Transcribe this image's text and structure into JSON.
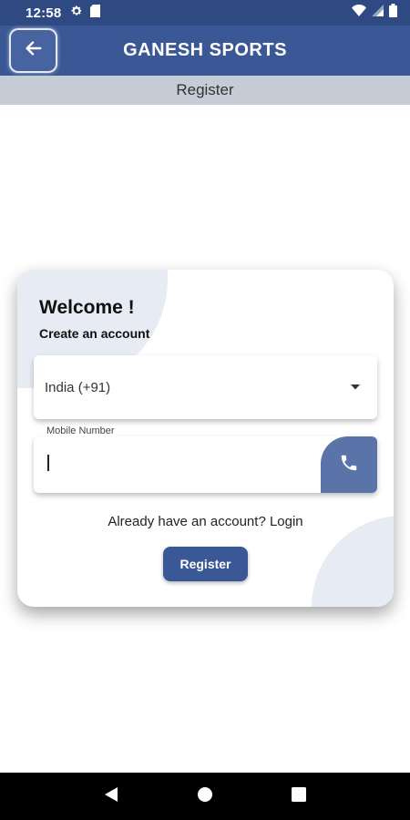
{
  "status_bar": {
    "time": "12:58"
  },
  "app_bar": {
    "title": "GANESH SPORTS"
  },
  "sub_header": {
    "title": "Register"
  },
  "card": {
    "welcome": "Welcome !",
    "subtitle": "Create an account",
    "country_select": {
      "selected": "India (+91)"
    },
    "mobile_field": {
      "label": "Mobile Number",
      "value": ""
    },
    "login_link": "Already have an account? Login",
    "register_button": "Register"
  },
  "icons": {
    "back": "arrow-left-icon",
    "settings": "gear-icon",
    "sim": "sim-card-icon",
    "wifi": "wifi-icon",
    "signal": "signal-icon",
    "battery": "battery-icon",
    "dropdown": "caret-down-icon",
    "phone": "phone-icon"
  },
  "colors": {
    "primary": "#3a5895",
    "status_bar": "#2f4a82",
    "sub_header": "#c6ccd6",
    "blob": "#e7ebf3",
    "phone_button": "#5a73a9"
  }
}
